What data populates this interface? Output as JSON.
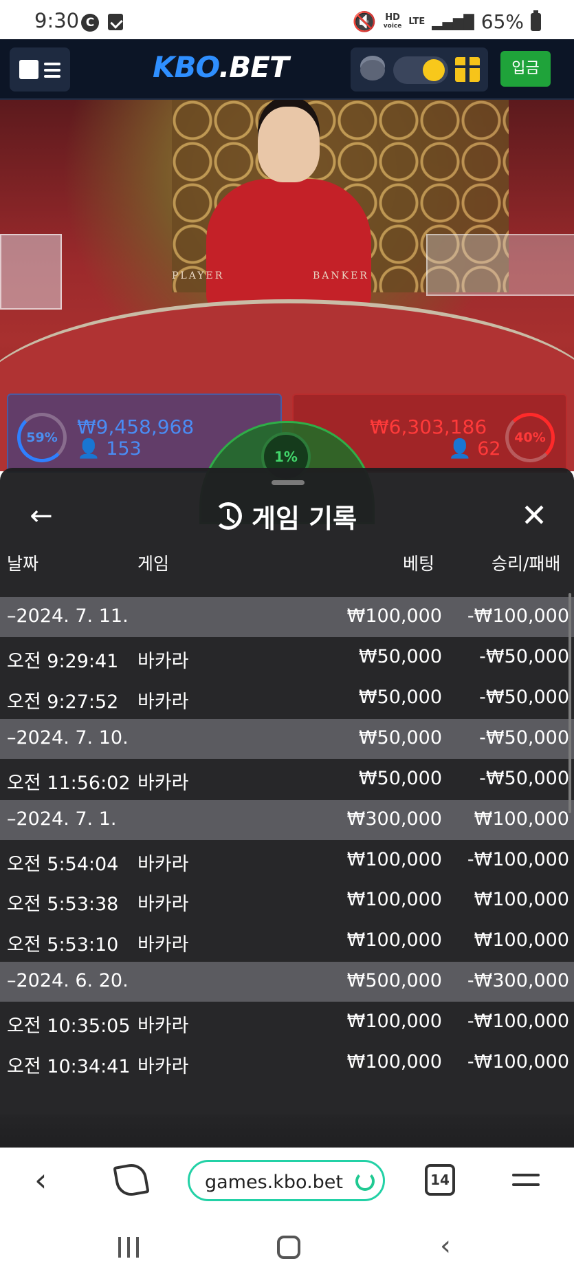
{
  "status_bar": {
    "time": "9:30",
    "c_badge": "C",
    "hd_label": "HD",
    "voice_label": "voice",
    "lte_label": "LTE",
    "battery": "65%"
  },
  "app_header": {
    "logo_kbo": "KBO",
    "logo_bet": ".BET",
    "deposit_label": "입금"
  },
  "live_table": {
    "player_label": "PLAYER",
    "banker_label": "BANKER",
    "player_percent": "59%",
    "player_amount": "₩9,458,968",
    "player_count": "153",
    "banker_amount": "₩6,303,186",
    "banker_count": "62",
    "banker_percent": "40%",
    "tie_percent": "1%"
  },
  "sheet": {
    "title": "게임 기록",
    "back_icon": "←",
    "close_icon": "✕",
    "columns": {
      "date": "날짜",
      "game": "게임",
      "bet": "베팅",
      "result": "승리/패배"
    },
    "rows": [
      {
        "type": "group",
        "date": "–2024. 7. 11.",
        "game": "",
        "bet": "₩100,000",
        "result": "-₩100,000"
      },
      {
        "type": "item",
        "date": "오전 9:29:41",
        "game": "바카라",
        "bet": "₩50,000",
        "result": "-₩50,000"
      },
      {
        "type": "item",
        "date": "오전 9:27:52",
        "game": "바카라",
        "bet": "₩50,000",
        "result": "-₩50,000"
      },
      {
        "type": "group",
        "date": "–2024. 7. 10.",
        "game": "",
        "bet": "₩50,000",
        "result": "-₩50,000"
      },
      {
        "type": "item",
        "date": "오전 11:56:02",
        "game": "바카라",
        "bet": "₩50,000",
        "result": "-₩50,000"
      },
      {
        "type": "group",
        "date": "–2024. 7. 1.",
        "game": "",
        "bet": "₩300,000",
        "result": "₩100,000"
      },
      {
        "type": "item",
        "date": "오전 5:54:04",
        "game": "바카라",
        "bet": "₩100,000",
        "result": "-₩100,000"
      },
      {
        "type": "item",
        "date": "오전 5:53:38",
        "game": "바카라",
        "bet": "₩100,000",
        "result": "₩100,000"
      },
      {
        "type": "item",
        "date": "오전 5:53:10",
        "game": "바카라",
        "bet": "₩100,000",
        "result": "₩100,000"
      },
      {
        "type": "group",
        "date": "–2024. 6. 20.",
        "game": "",
        "bet": "₩500,000",
        "result": "-₩300,000"
      },
      {
        "type": "item",
        "date": "오전 10:35:05",
        "game": "바카라",
        "bet": "₩100,000",
        "result": "-₩100,000"
      },
      {
        "type": "item",
        "date": "오전 10:34:41",
        "game": "바카라",
        "bet": "₩100,000",
        "result": "-₩100,000"
      }
    ]
  },
  "browser": {
    "url": "games.kbo.bet",
    "tab_count": "14"
  }
}
